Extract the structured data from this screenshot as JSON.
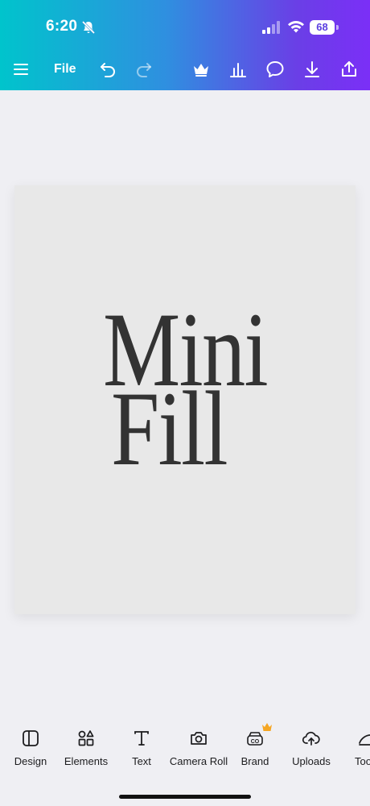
{
  "status_bar": {
    "time": "6:20",
    "battery": "68"
  },
  "toolbar": {
    "file_label": "File"
  },
  "design": {
    "line1": "Mini",
    "line2": "Fill"
  },
  "bottom_nav": {
    "design": "Design",
    "elements": "Elements",
    "text": "Text",
    "camera_roll": "Camera Roll",
    "brand": "Brand",
    "uploads": "Uploads",
    "tools": "Too"
  },
  "colors": {
    "gradient_start": "#00c4cc",
    "gradient_end": "#7b2ff7",
    "canvas_bg": "#e8e8e8",
    "crown": "#f5a623"
  },
  "icons": [
    "menu-icon",
    "undo-icon",
    "redo-icon",
    "crown-icon",
    "chart-icon",
    "comment-icon",
    "download-icon",
    "share-icon"
  ]
}
